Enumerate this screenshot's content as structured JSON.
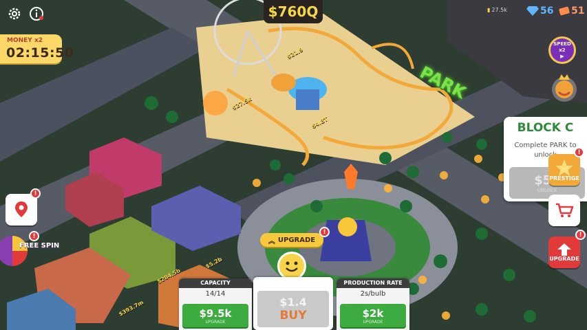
{
  "top_left": {
    "settings_icon": "gear-icon",
    "info_icon": "info-icon"
  },
  "money_boost": {
    "label": "MONEY x2",
    "timer": "02:15:50"
  },
  "balance": "$760Q",
  "currencies": {
    "earnings": "27.5k",
    "gems": "56",
    "tickets": "51"
  },
  "speed_button": {
    "line1": "SPEED",
    "line2": "x2"
  },
  "park_sign": "PARK",
  "block_panel": {
    "title": "BLOCK C",
    "subtitle": "Complete PARK to unlock",
    "price": "$50",
    "button_label": "UNLOCK"
  },
  "side_buttons": {
    "prestige": "PRESTIGE",
    "shop_icon": "cart-icon",
    "upgrade": "UPGRADE",
    "badge": "!"
  },
  "left_buttons": {
    "map_icon": "map-pin-icon",
    "free_spin": "FREE SPIN",
    "badge": "!"
  },
  "bottom": {
    "upgrade_pill": "UPGRADE",
    "capacity": {
      "title": "CAPACITY",
      "value": "14/14",
      "price": "$9.5k",
      "label": "UPGRADE"
    },
    "buy": {
      "price": "$1.4",
      "label": "BUY"
    },
    "production": {
      "title": "PRODUCTION RATE",
      "value": "2s/bulb",
      "price": "$2k",
      "label": "UPGRADE"
    }
  },
  "money_tags": [
    "$5.2b",
    "$284.5b",
    "$393.7m",
    "$27.5k",
    "$4.8T",
    "$21.9"
  ],
  "colors": {
    "grass": "#2b3a2e",
    "park_ground": "#e7cf8f",
    "road": "#5b5f6a",
    "gold": "#f7d64a",
    "green_button": "#3dab3f",
    "red": "#e23a3a"
  }
}
